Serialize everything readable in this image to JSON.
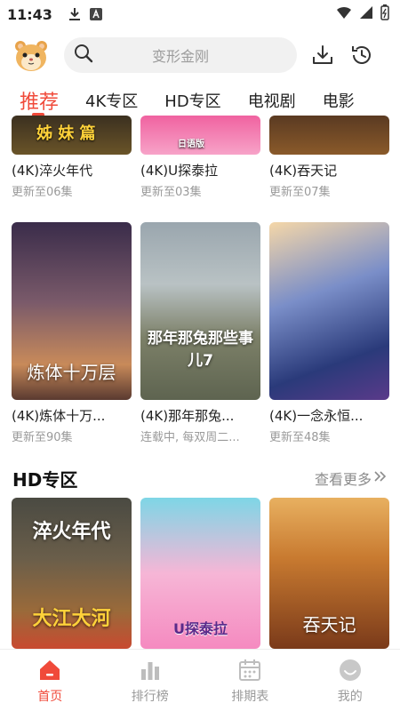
{
  "status_bar": {
    "time": "11:43"
  },
  "header": {
    "search_placeholder": "变形金刚"
  },
  "tabs": [
    {
      "label": "推荐",
      "active": true
    },
    {
      "label": "4K专区",
      "active": false
    },
    {
      "label": "HD专区",
      "active": false
    },
    {
      "label": "电视剧",
      "active": false
    },
    {
      "label": "电影",
      "active": false
    }
  ],
  "rows": [
    {
      "cards": [
        {
          "title": "(4K)淬火年代",
          "subtitle": "更新至06集",
          "poster_text": "姊 妹 篇"
        },
        {
          "title": "(4K)U探泰拉",
          "subtitle": "更新至03集",
          "poster_text": "日语版"
        },
        {
          "title": "(4K)吞天记",
          "subtitle": "更新至07集",
          "poster_text": ""
        }
      ]
    },
    {
      "cards": [
        {
          "title": "(4K)炼体十万...",
          "subtitle": "更新至90集",
          "poster_text": "炼体十万层"
        },
        {
          "title": "(4K)那年那兔...",
          "subtitle": "连载中, 每双周二...",
          "poster_text": "那年那兔那些事儿7"
        },
        {
          "title": "(4K)一念永恒...",
          "subtitle": "更新至48集",
          "poster_text": ""
        }
      ]
    }
  ],
  "hd_section": {
    "title": "HD专区",
    "more_label": "查看更多",
    "cards": [
      {
        "poster_text": "淬火年代",
        "poster_text_2": "大江大河"
      },
      {
        "poster_text": "U探泰拉"
      },
      {
        "poster_text": "吞天记"
      }
    ]
  },
  "bottom_nav": [
    {
      "label": "首页",
      "active": true
    },
    {
      "label": "排行榜",
      "active": false
    },
    {
      "label": "排期表",
      "active": false
    },
    {
      "label": "我的",
      "active": false
    }
  ],
  "colors": {
    "accent": "#f04a3a",
    "muted": "#9a9a9a"
  }
}
